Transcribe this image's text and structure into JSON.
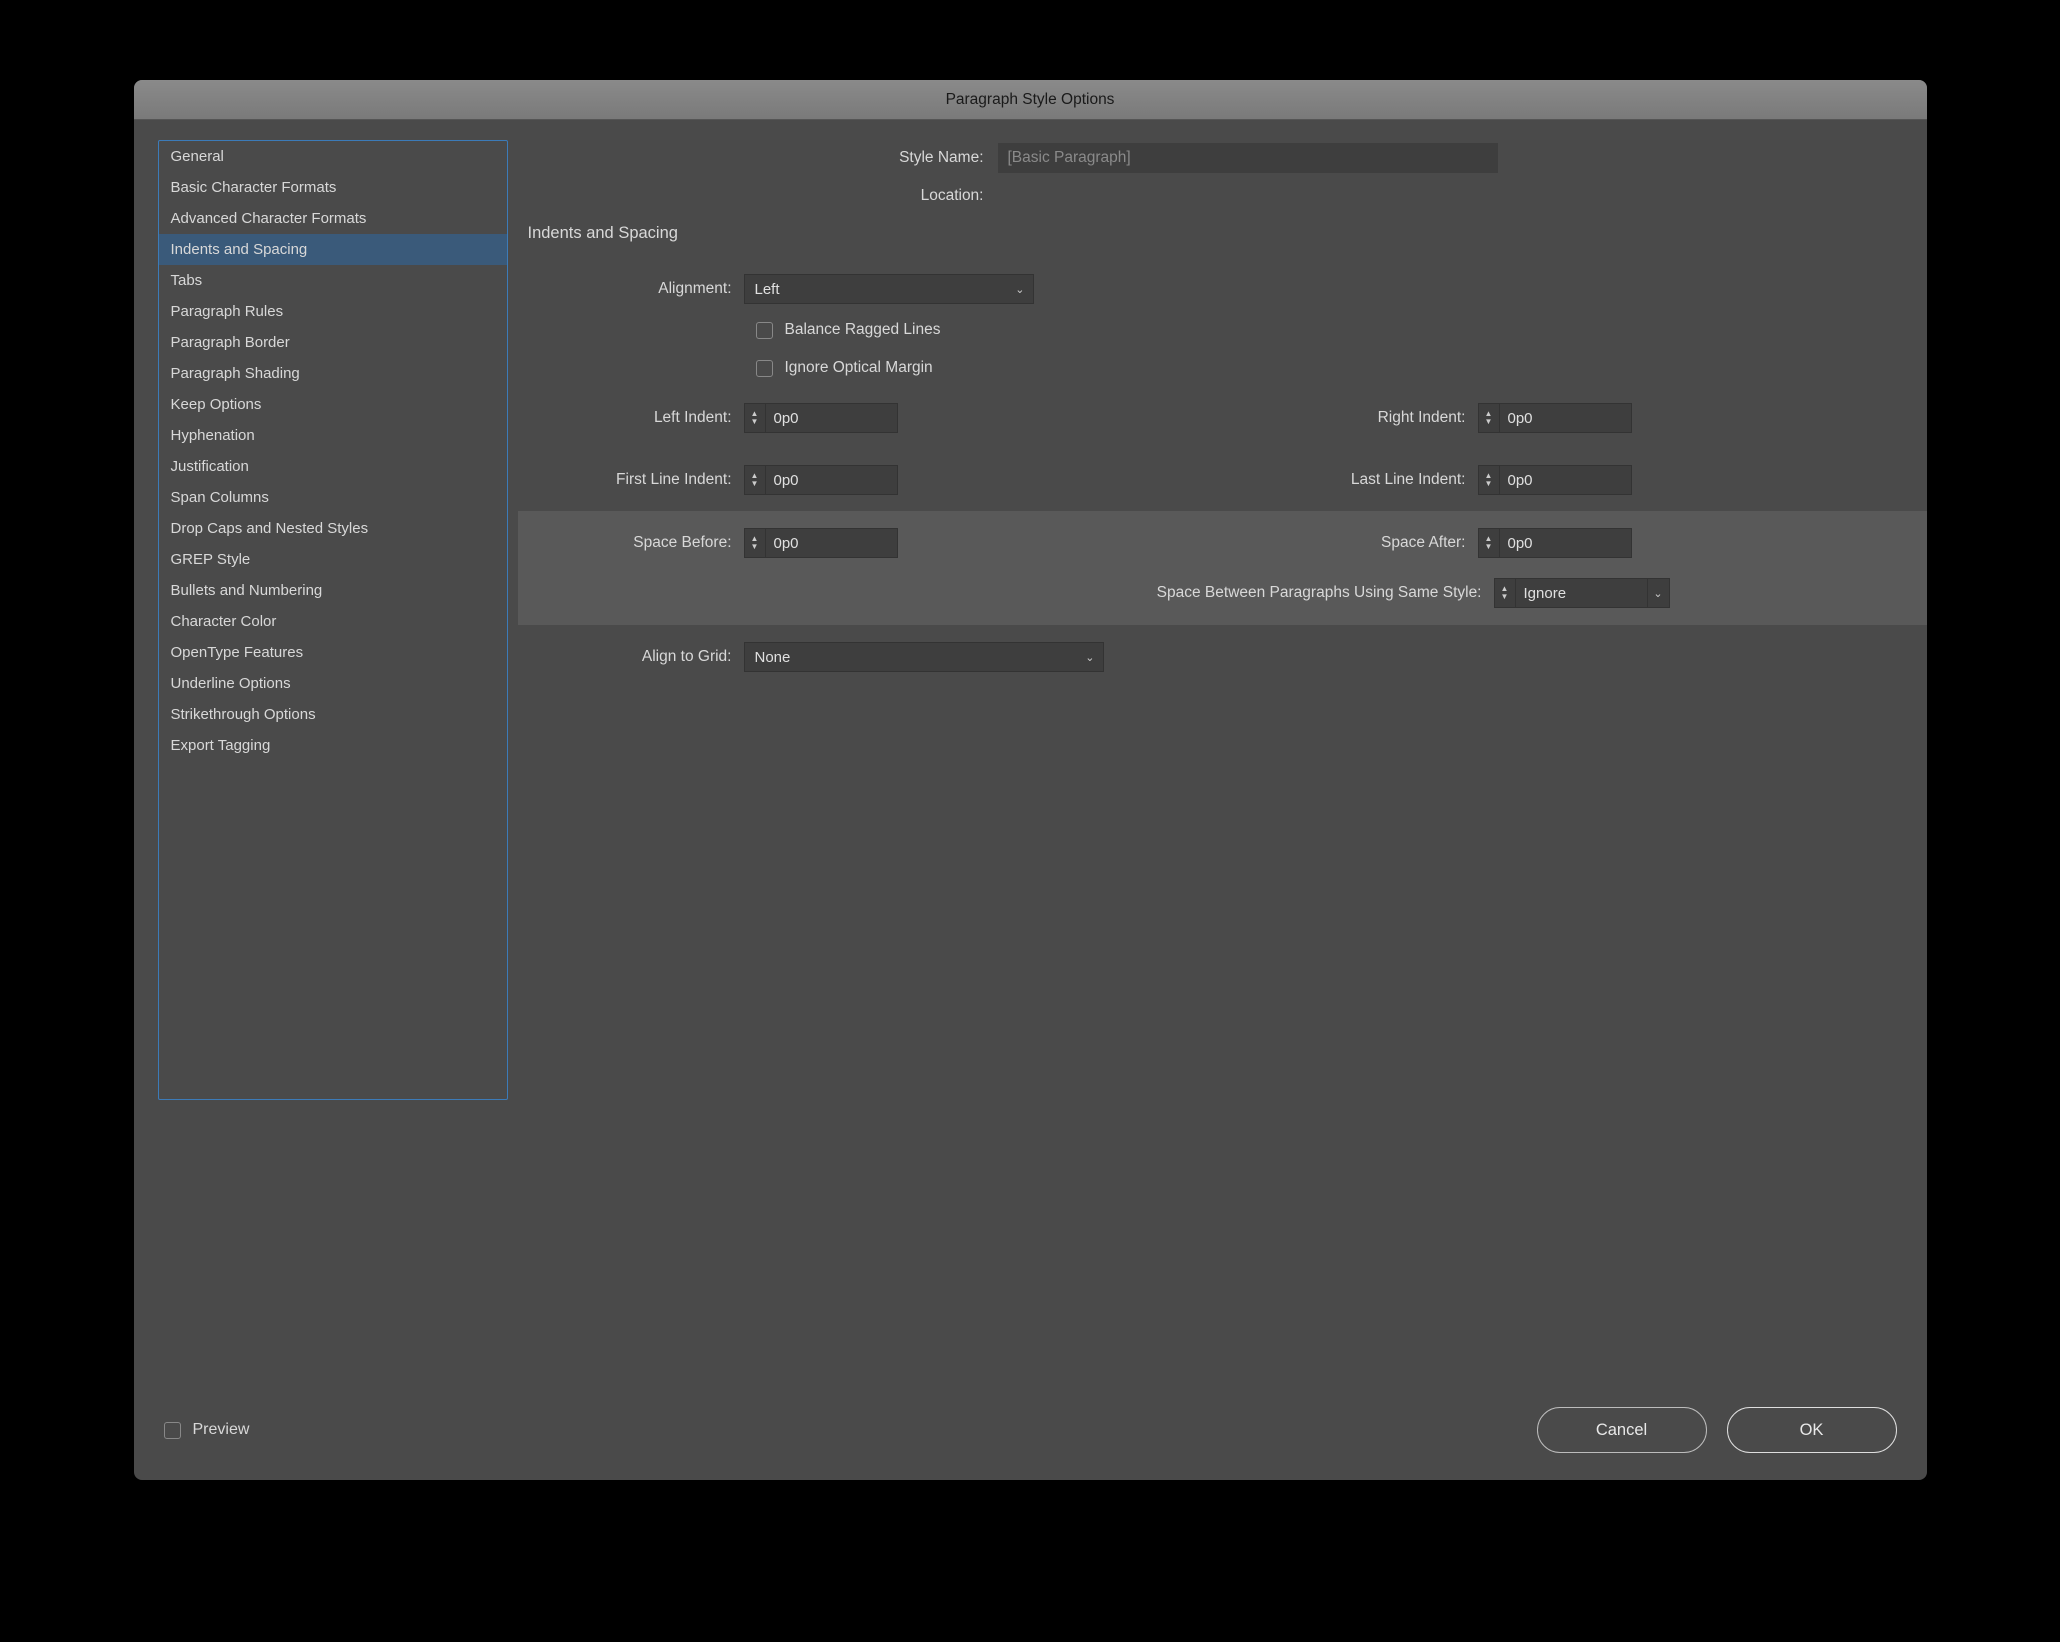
{
  "dialog": {
    "title": "Paragraph Style Options"
  },
  "sidebar": {
    "items": [
      "General",
      "Basic Character Formats",
      "Advanced Character Formats",
      "Indents and Spacing",
      "Tabs",
      "Paragraph Rules",
      "Paragraph Border",
      "Paragraph Shading",
      "Keep Options",
      "Hyphenation",
      "Justification",
      "Span Columns",
      "Drop Caps and Nested Styles",
      "GREP Style",
      "Bullets and Numbering",
      "Character Color",
      "OpenType Features",
      "Underline Options",
      "Strikethrough Options",
      "Export Tagging"
    ],
    "selected_index": 3
  },
  "header": {
    "style_name_label": "Style Name:",
    "style_name_value": "[Basic Paragraph]",
    "location_label": "Location:"
  },
  "section": {
    "title": "Indents and Spacing",
    "alignment_label": "Alignment:",
    "alignment_value": "Left",
    "balance_ragged_label": "Balance Ragged Lines",
    "ignore_optical_label": "Ignore Optical Margin",
    "left_indent_label": "Left Indent:",
    "left_indent_value": "0p0",
    "right_indent_label": "Right Indent:",
    "right_indent_value": "0p0",
    "first_line_label": "First Line Indent:",
    "first_line_value": "0p0",
    "last_line_label": "Last Line Indent:",
    "last_line_value": "0p0",
    "space_before_label": "Space Before:",
    "space_before_value": "0p0",
    "space_after_label": "Space After:",
    "space_after_value": "0p0",
    "space_between_label": "Space Between Paragraphs Using Same Style:",
    "space_between_value": "Ignore",
    "align_grid_label": "Align to Grid:",
    "align_grid_value": "None"
  },
  "footer": {
    "preview_label": "Preview",
    "cancel_label": "Cancel",
    "ok_label": "OK"
  }
}
